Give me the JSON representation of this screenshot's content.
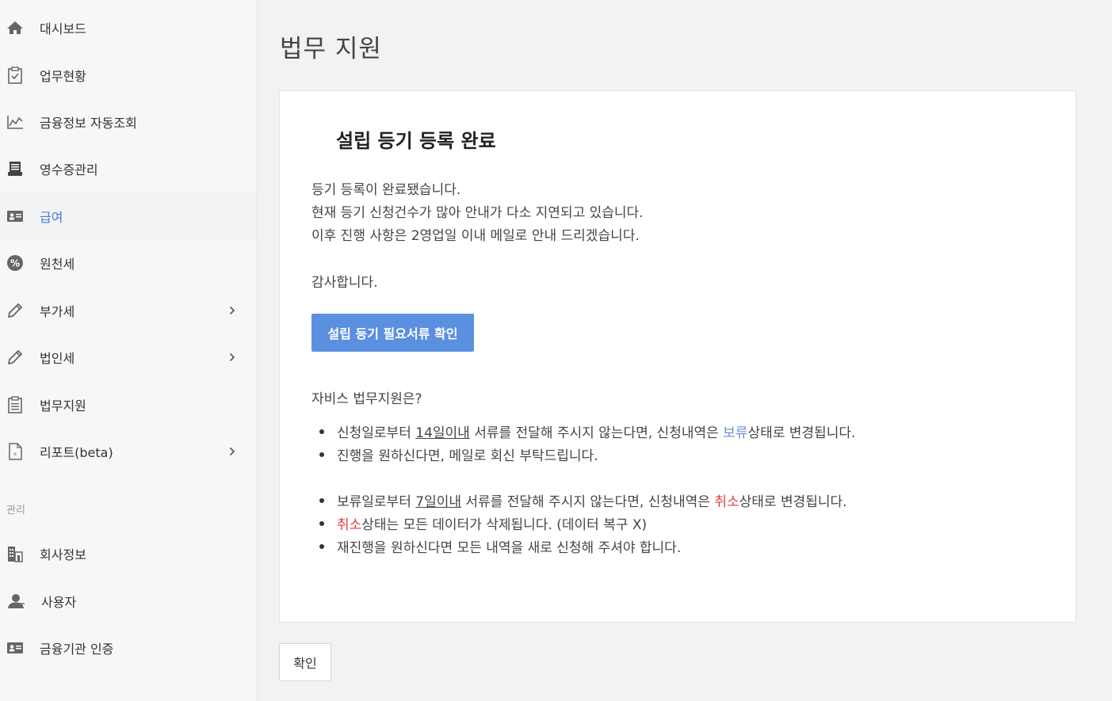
{
  "sidebar": {
    "items": [
      {
        "label": "대시보드",
        "icon": "home-icon"
      },
      {
        "label": "업무현황",
        "icon": "clipboard-check-icon"
      },
      {
        "label": "금융정보 자동조회",
        "icon": "line-chart-icon"
      },
      {
        "label": "영수증관리",
        "icon": "receipt-icon"
      },
      {
        "label": "급여",
        "icon": "id-card-icon"
      },
      {
        "label": "원천세",
        "icon": "percent-icon"
      },
      {
        "label": "부가세",
        "icon": "pencil-icon"
      },
      {
        "label": "법인세",
        "icon": "pencil-icon"
      },
      {
        "label": "법무지원",
        "icon": "clipboard-icon"
      },
      {
        "label": "리포트(beta)",
        "icon": "report-icon"
      }
    ],
    "section_label": "관리",
    "manage_items": [
      {
        "label": "회사정보",
        "icon": "building-icon"
      },
      {
        "label": "사용자",
        "icon": "user-icon"
      },
      {
        "label": "금융기관 인증",
        "icon": "id-card-icon"
      }
    ]
  },
  "main": {
    "page_title": "법무 지원",
    "card": {
      "title": "설립 등기 등록 완료",
      "messages": [
        "등기 등록이 완료됐습니다.",
        "현재 등기 신청건수가 많아 안내가 다소 지연되고 있습니다.",
        "이후 진행 사항은 2영업일 이내 메일로 안내 드리겠습니다."
      ],
      "thanks": "감사합니다.",
      "primary_button": "설립 등기 필요서류 확인",
      "info_heading": "자비스 법무지원은?",
      "bullets": {
        "b1_pre": "신청일로부터 ",
        "b1_u": "14일이내",
        "b1_mid": " 서류를 전달해 주시지 않는다면, 신청내역은 ",
        "b1_hold": "보류",
        "b1_post": "상태로 변경됩니다.",
        "b2": "진행을 원하신다면, 메일로 회신 부탁드립니다.",
        "b3_pre": "보류일로부터 ",
        "b3_u": "7일이내",
        "b3_mid": " 서류를 전달해 주시지 않는다면, 신청내역은 ",
        "b3_cancel": "취소",
        "b3_post": "상태로 변경됩니다.",
        "b4_cancel": "취소",
        "b4_post": "상태는 모든 데이터가 삭제됩니다. (데이터 복구 X)",
        "b5": "재진행을 원하신다면 모든 내역을 새로 신청해 주셔야 합니다."
      }
    },
    "confirm_button": "확인"
  },
  "colors": {
    "accent": "#5b8fe0",
    "active_nav": "#4a7fd6",
    "hold": "#6a8fcf",
    "cancel": "#e04040"
  }
}
